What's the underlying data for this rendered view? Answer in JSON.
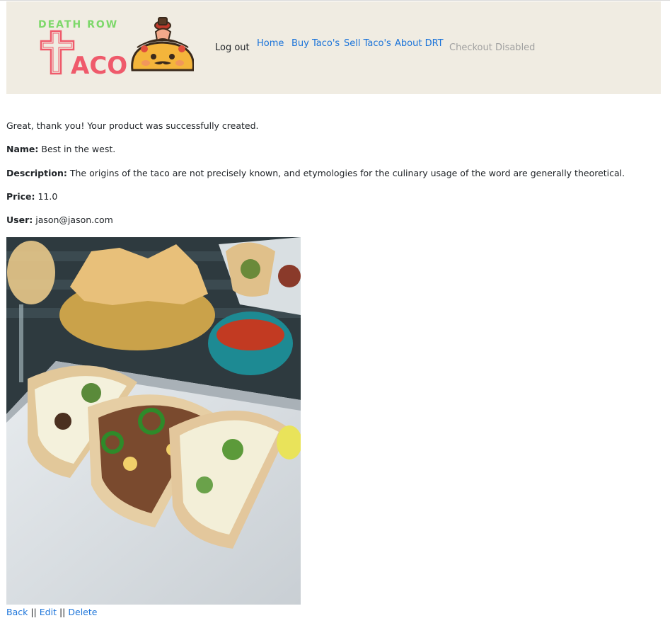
{
  "brand": {
    "line1": "DEATH ROW",
    "line2": "ACO"
  },
  "nav": {
    "logout": "Log out",
    "home": "Home",
    "buy": "Buy Taco's",
    "sell": "Sell Taco's",
    "about": "About DRT",
    "checkout": "Checkout Disabled"
  },
  "notice": "Great, thank you! Your product was successfully created.",
  "product": {
    "name_label": "Name:",
    "name": "Best in the west.",
    "description_label": "Description:",
    "description": "The origins of the taco are not precisely known, and etymologies for the culinary usage of the word are generally theoretical.",
    "price_label": "Price:",
    "price": "11.0",
    "user_label": "User:",
    "user": "jason@jason.com"
  },
  "actions": {
    "back": "Back",
    "edit": "Edit",
    "delete": "Delete",
    "separator": "||"
  },
  "colors": {
    "navbar_bg": "#f0ece2",
    "link": "#1a73d9",
    "disabled": "#a0a0a0",
    "brand_green": "#7dd86a",
    "brand_red": "#ef5a6b"
  },
  "icons": [
    "taco-mascot-icon",
    "cross-icon"
  ]
}
